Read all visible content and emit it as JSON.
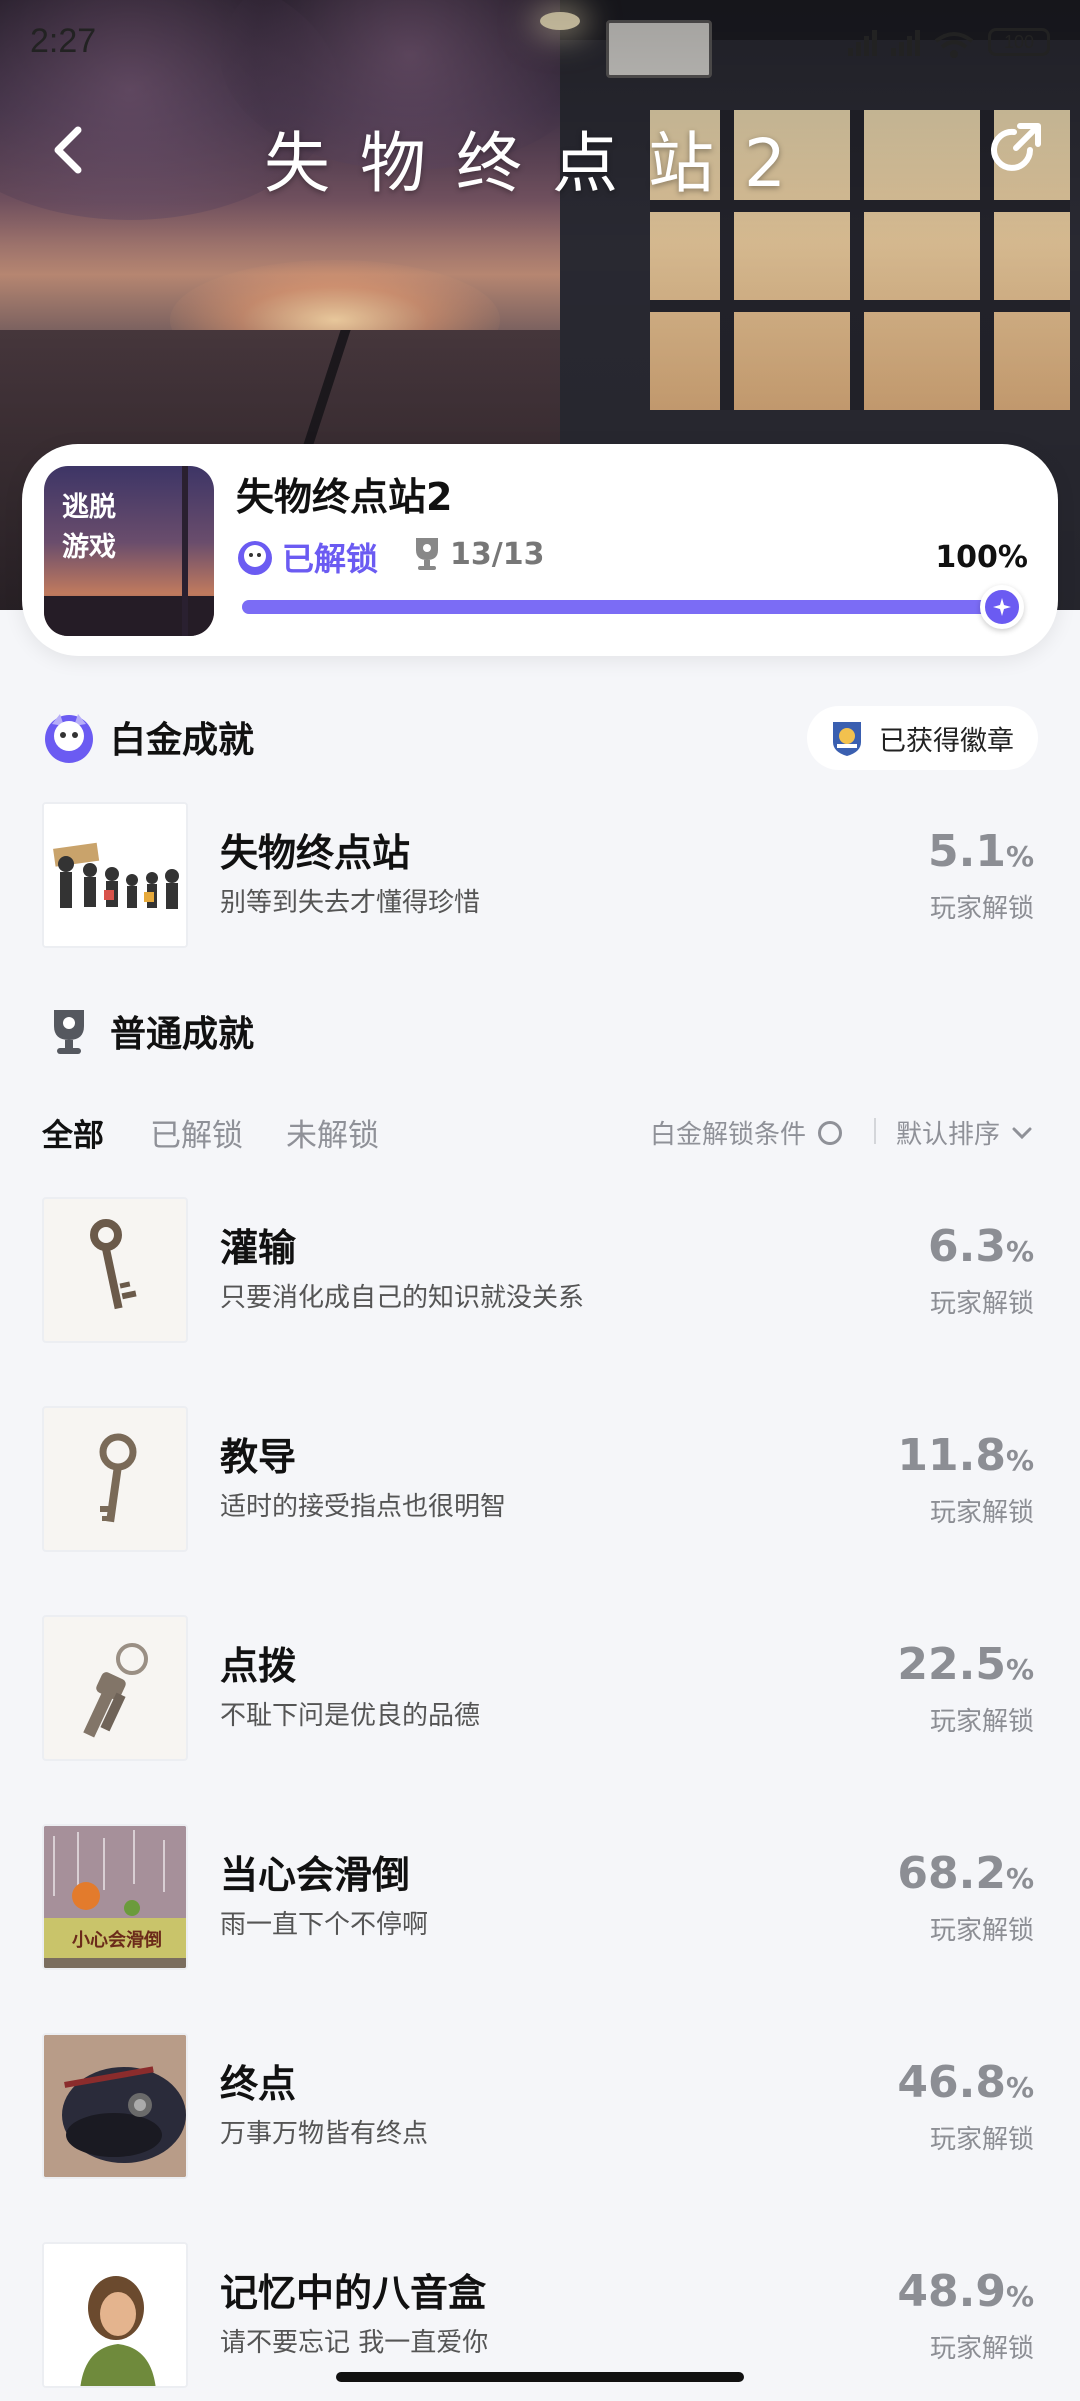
{
  "status_bar": {
    "time": "2:27",
    "battery": "100"
  },
  "header": {
    "title": "失物终点站2",
    "back_icon": "chevron-left-icon",
    "share_icon": "share-icon"
  },
  "game_card": {
    "cover_text": "逃脱\n游戏",
    "name": "失物终点站2",
    "status": "已解锁",
    "trophy_count": "13/13",
    "percent_label": "100%",
    "progress": 1.0,
    "accent_color": "#6b5bf2"
  },
  "platinum": {
    "heading": "白金成就",
    "badge_button": "已获得徽章",
    "item": {
      "name": "失物终点站",
      "desc": "别等到失去才懂得珍惜",
      "pct": "5.1",
      "unit": "%",
      "pct_label": "玩家解锁"
    }
  },
  "normal": {
    "heading": "普通成就",
    "tabs": [
      "全部",
      "已解锁",
      "未解锁"
    ],
    "active_tab": "全部",
    "condition_label": "白金解锁条件",
    "sort_label": "默认排序",
    "items": [
      {
        "name": "灌输",
        "desc": "只要消化成自己的知识就没关系",
        "pct": "6.3",
        "unit": "%",
        "pct_label": "玩家解锁",
        "icon": "old-key-icon"
      },
      {
        "name": "教导",
        "desc": "适时的接受指点也很明智",
        "pct": "11.8",
        "unit": "%",
        "pct_label": "玩家解锁",
        "icon": "ring-key-icon"
      },
      {
        "name": "点拨",
        "desc": "不耻下问是优良的品德",
        "pct": "22.5",
        "unit": "%",
        "pct_label": "玩家解锁",
        "icon": "keychain-icon"
      },
      {
        "name": "当心会滑倒",
        "desc": "雨一直下个不停啊",
        "pct": "68.2",
        "unit": "%",
        "pct_label": "玩家解锁",
        "icon": "slippery-sign-icon",
        "thumb_text": "小心会滑倒"
      },
      {
        "name": "终点",
        "desc": "万事万物皆有终点",
        "pct": "46.8",
        "unit": "%",
        "pct_label": "玩家解锁",
        "icon": "conductor-cap-icon"
      },
      {
        "name": "记忆中的八音盒",
        "desc": "请不要忘记 我一直爱你",
        "pct": "48.9",
        "unit": "%",
        "pct_label": "玩家解锁",
        "icon": "portrait-icon"
      }
    ]
  }
}
